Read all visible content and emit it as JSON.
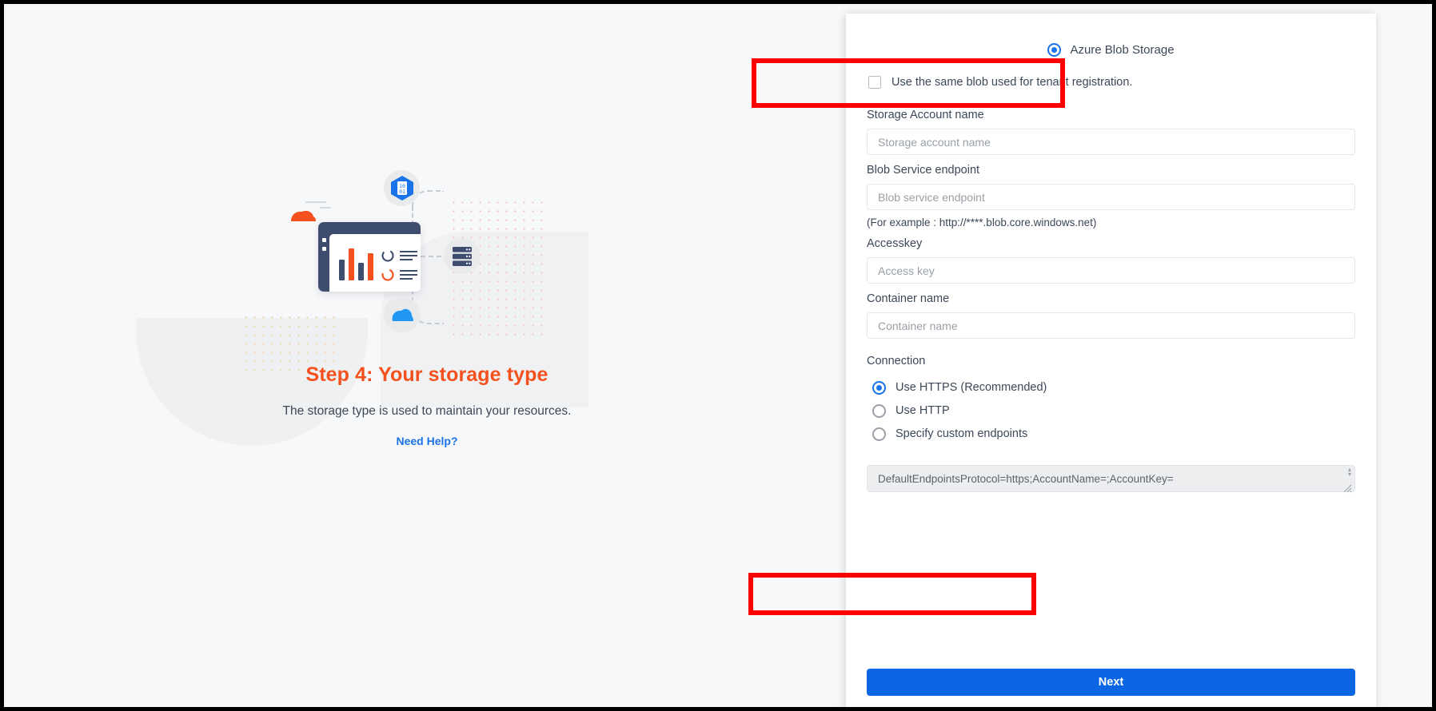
{
  "left": {
    "step_title": "Step 4: Your storage type",
    "subtitle": "The storage type is used to maintain your resources.",
    "help_link": "Need Help?",
    "illustration": {
      "hex_badge_text_top": "10",
      "hex_badge_text_bottom": "01"
    }
  },
  "form": {
    "storage_type": {
      "selected_label": "Azure Blob Storage"
    },
    "same_blob_checkbox": {
      "label": "Use the same blob used for tenant registration.",
      "checked": false
    },
    "fields": {
      "storage_account": {
        "label": "Storage Account name",
        "placeholder": "Storage account name",
        "value": ""
      },
      "blob_endpoint": {
        "label": "Blob Service endpoint",
        "placeholder": "Blob service endpoint",
        "value": "",
        "hint": "(For example : http://****.blob.core.windows.net)"
      },
      "accesskey": {
        "label": "Accesskey",
        "placeholder": "Access key",
        "value": ""
      },
      "container_name": {
        "label": "Container name",
        "placeholder": "Container name",
        "value": ""
      }
    },
    "connection": {
      "label": "Connection",
      "options": [
        {
          "label": "Use HTTPS (Recommended)",
          "selected": true
        },
        {
          "label": "Use HTTP",
          "selected": false
        },
        {
          "label": "Specify custom endpoints",
          "selected": false
        }
      ]
    },
    "connection_string": {
      "value": "DefaultEndpointsProtocol=https;AccountName=;AccountKey="
    },
    "next_button": "Next"
  },
  "colors": {
    "accent_orange": "#f4511e",
    "link_blue": "#1a73e8",
    "primary_blue": "#0b66e4",
    "highlight_red": "#ff0000",
    "text_dark": "#3c4858",
    "placeholder_grey": "#9aa0a6"
  }
}
